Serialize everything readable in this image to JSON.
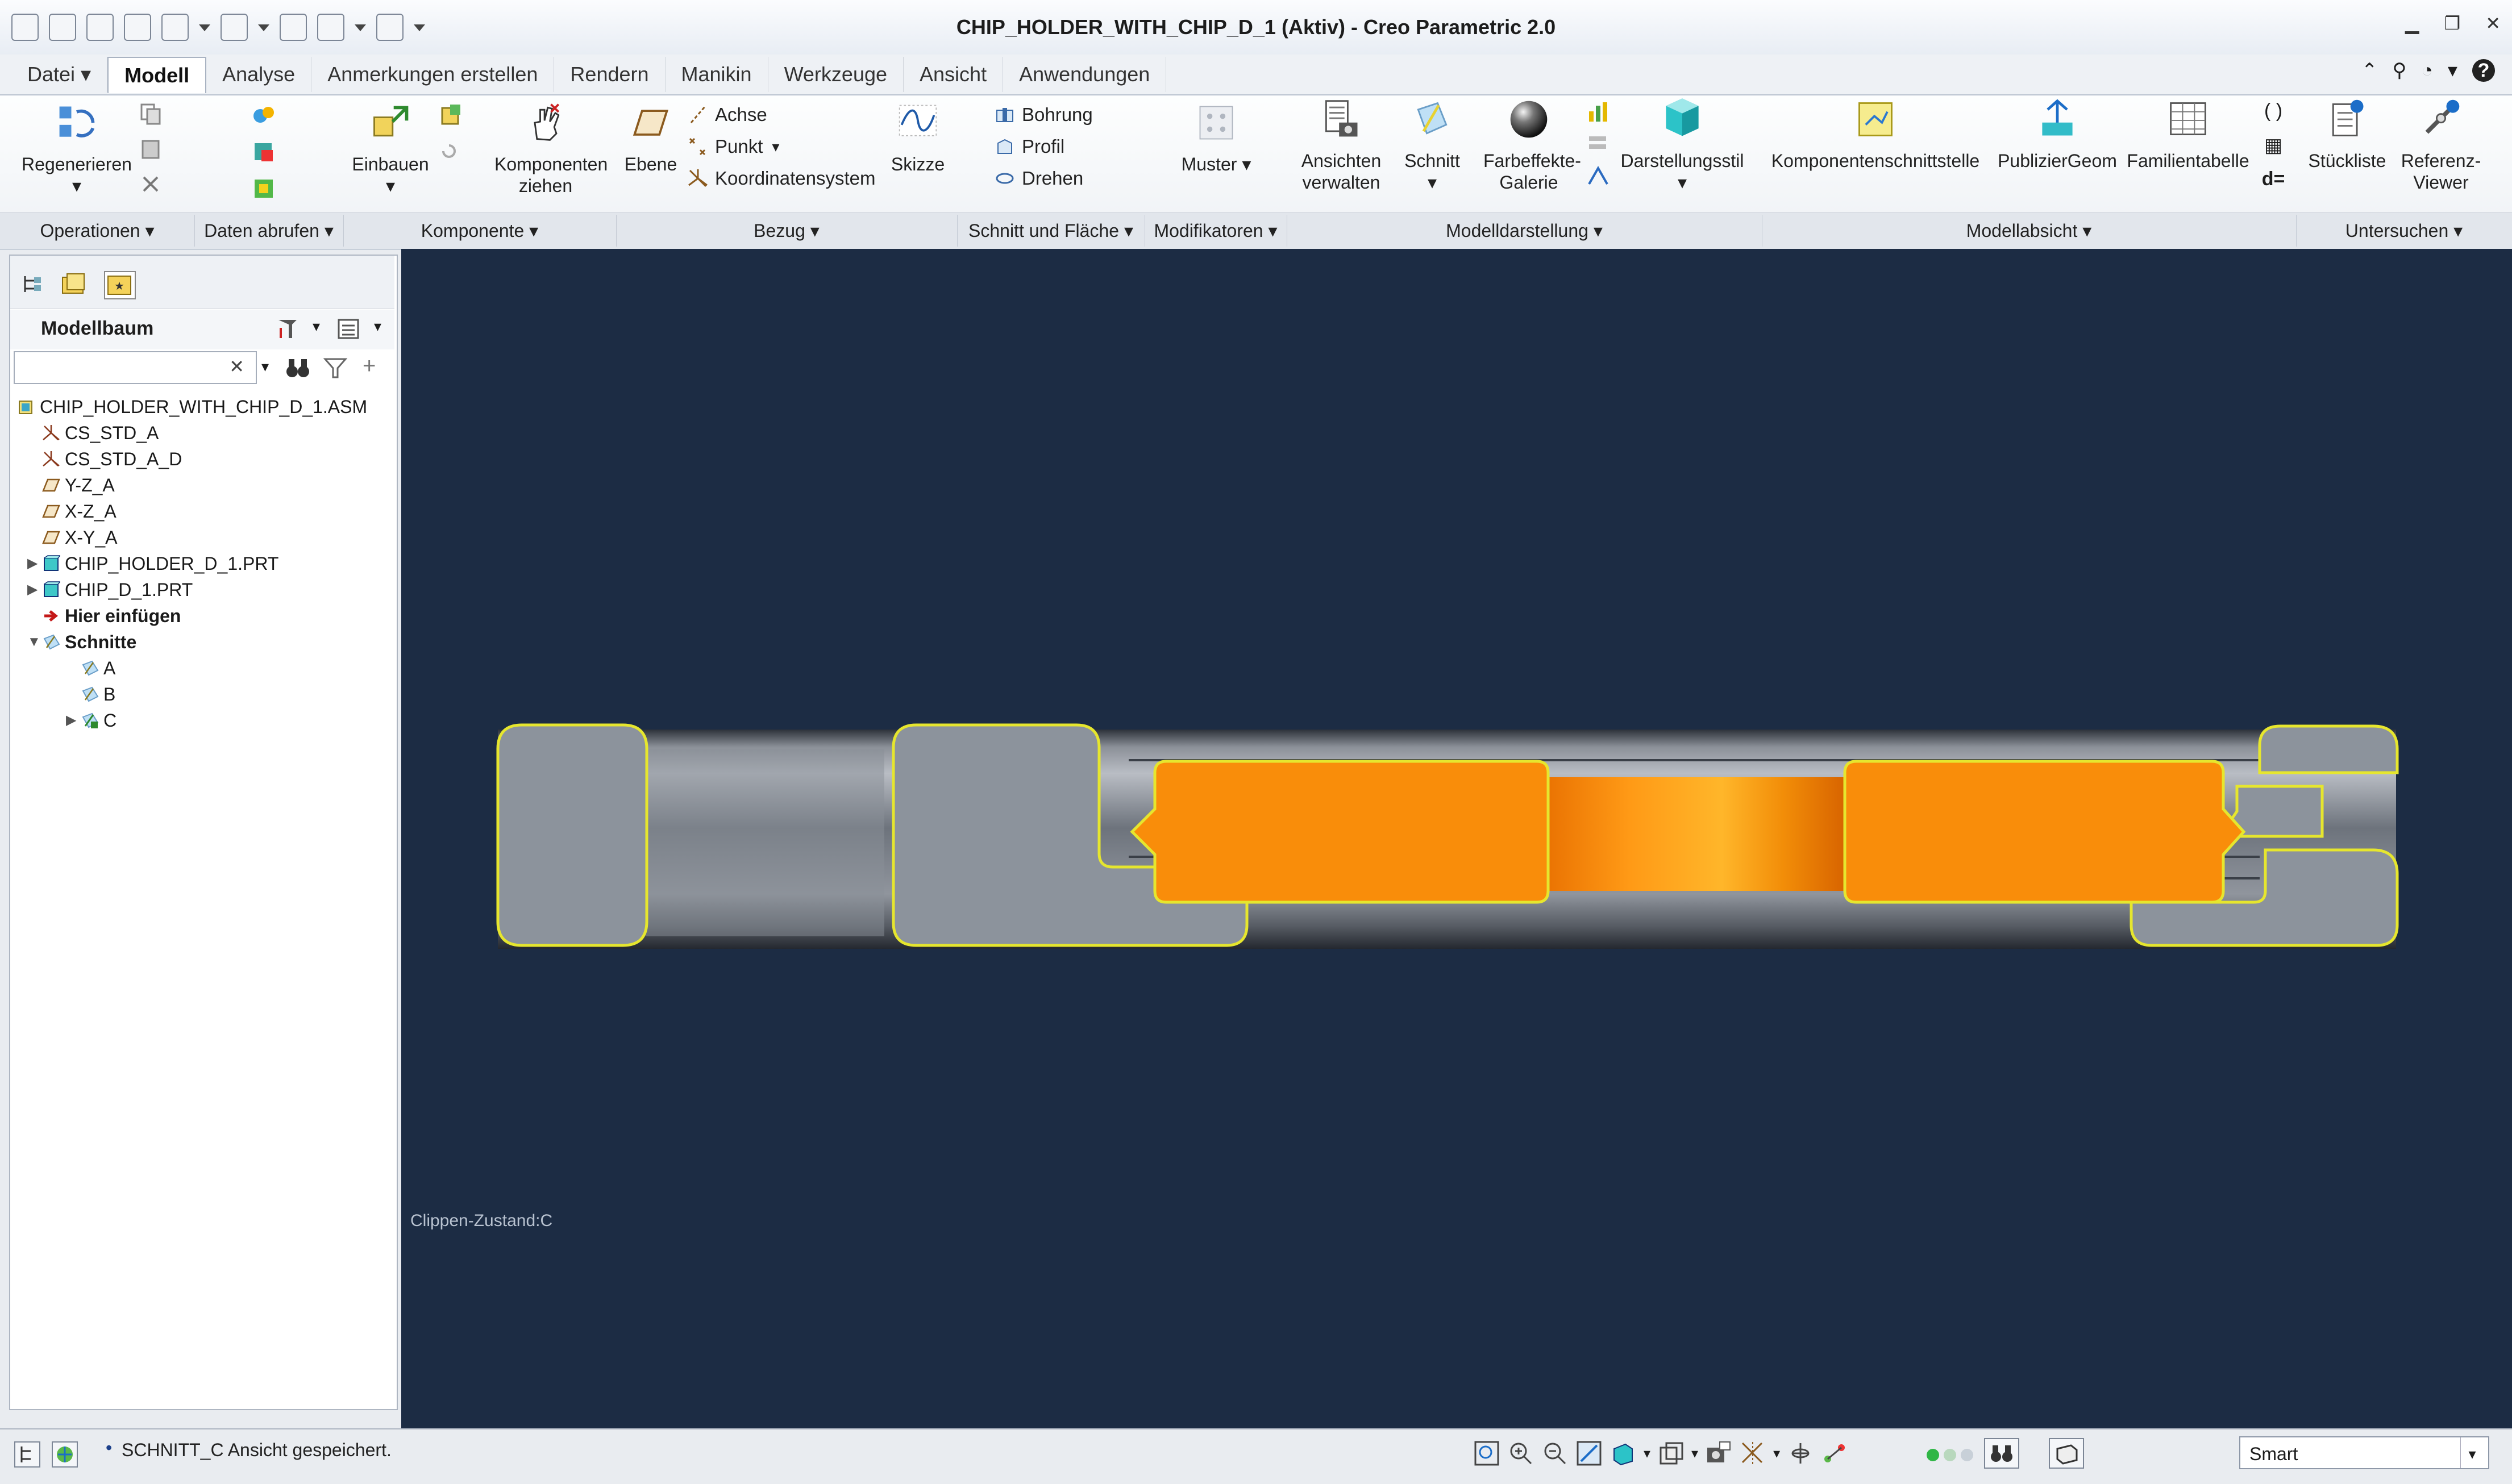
{
  "window": {
    "title": "CHIP_HOLDER_WITH_CHIP_D_1 (Aktiv) - Creo Parametric 2.0"
  },
  "tabs": [
    "Datei",
    "Modell",
    "Analyse",
    "Anmerkungen erstellen",
    "Rendern",
    "Manikin",
    "Werkzeuge",
    "Ansicht",
    "Anwendungen"
  ],
  "ribbon": {
    "regenerieren": "Regenerieren",
    "einbauen": "Einbauen",
    "komponenten_ziehen": "Komponenten ziehen",
    "ebene": "Ebene",
    "achse": "Achse",
    "punkt": "Punkt",
    "koordinatensystem": "Koordinatensystem",
    "skizze": "Skizze",
    "bohrung": "Bohrung",
    "profil": "Profil",
    "drehen": "Drehen",
    "muster": "Muster",
    "ansichten_verwalten": "Ansichten verwalten",
    "schnitt": "Schnitt",
    "farbeffekte_galerie": "Farbeffekte- Galerie",
    "darstellungsstil": "Darstellungsstil",
    "komponentenschnittstelle": "Komponentenschnittstelle",
    "publiziergeom": "PublizierGeom",
    "familientabelle": "Familientabelle",
    "stueckliste": "Stückliste",
    "referenz_viewer": "Referenz- Viewer",
    "d_eq": "d="
  },
  "groups": [
    "Operationen",
    "Daten abrufen",
    "Komponente",
    "Bezug",
    "Schnitt und Fläche",
    "Modifikatoren",
    "Modelldarstellung",
    "Modellabsicht",
    "Untersuchen"
  ],
  "sidebar": {
    "title": "Modellbaum",
    "tree": [
      {
        "label": "CHIP_HOLDER_WITH_CHIP_D_1.ASM",
        "level": 0,
        "icon": "assembly-icon"
      },
      {
        "label": "CS_STD_A",
        "level": 1,
        "icon": "csys-icon"
      },
      {
        "label": "CS_STD_A_D",
        "level": 1,
        "icon": "csys-icon"
      },
      {
        "label": "Y-Z_A",
        "level": 1,
        "icon": "plane-icon"
      },
      {
        "label": "X-Z_A",
        "level": 1,
        "icon": "plane-icon"
      },
      {
        "label": "X-Y_A",
        "level": 1,
        "icon": "plane-icon"
      },
      {
        "label": "CHIP_HOLDER_D_1.PRT",
        "level": 1,
        "icon": "part-icon",
        "expandable": true
      },
      {
        "label": "CHIP_D_1.PRT",
        "level": 1,
        "icon": "part-icon",
        "expandable": true
      },
      {
        "label": "Hier einfügen",
        "level": 1,
        "icon": "insert-arrow-icon"
      },
      {
        "label": "Schnitte",
        "level": 1,
        "icon": "sections-icon",
        "expanded": true
      },
      {
        "label": "A",
        "level": 2,
        "icon": "section-icon"
      },
      {
        "label": "B",
        "level": 2,
        "icon": "section-icon"
      },
      {
        "label": "C",
        "level": 2,
        "icon": "section-active-icon",
        "expandable": true
      }
    ]
  },
  "viewport": {
    "clip_label": "Clippen-Zustand:C"
  },
  "status": {
    "message": "SCHNITT_C Ansicht gespeichert.",
    "filter": "Smart"
  },
  "colors": {
    "viewport_bg": "#1c2c44",
    "chip_orange": "#f98d0a",
    "holder_grey": "#8c939c",
    "edge_yellow": "#e6e62e"
  }
}
